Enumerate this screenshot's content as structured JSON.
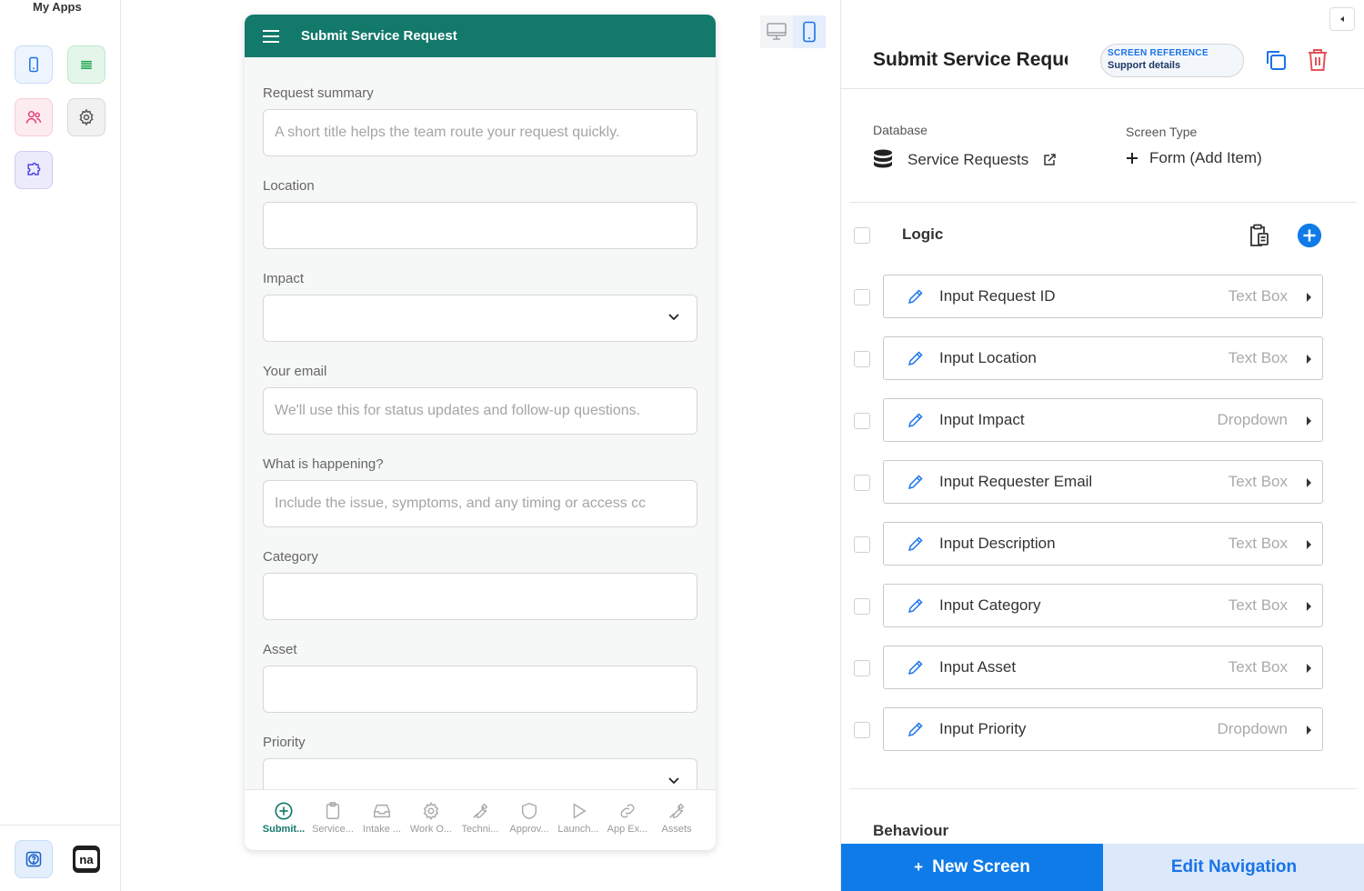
{
  "sidebar": {
    "title": "My Apps",
    "buttons": [
      {
        "icon": "mobile-app-icon",
        "color": "#1a73e8"
      },
      {
        "icon": "list-icon",
        "color": "#16a34a"
      },
      {
        "icon": "users-icon",
        "color": "#e0457b"
      },
      {
        "icon": "gear-icon",
        "color": "#555555"
      },
      {
        "icon": "puzzle-icon",
        "color": "#4f46e5"
      }
    ],
    "bottom": [
      {
        "icon": "help-icon"
      },
      {
        "icon": "na-logo-icon",
        "label": "na"
      }
    ]
  },
  "phone": {
    "header_title": "Submit Service Request",
    "header_color": "#13796b",
    "fields": [
      {
        "label": "Request summary",
        "placeholder": "A short title helps the team route your request quickly.",
        "kind": "text"
      },
      {
        "label": "Location",
        "placeholder": "",
        "kind": "text"
      },
      {
        "label": "Impact",
        "placeholder": "",
        "kind": "dropdown"
      },
      {
        "label": "Your email",
        "placeholder": "We'll use this for status updates and follow-up questions.",
        "kind": "text"
      },
      {
        "label": "What is happening?",
        "placeholder": "Include the issue, symptoms, and any timing or access cc",
        "kind": "text"
      },
      {
        "label": "Category",
        "placeholder": "",
        "kind": "text"
      },
      {
        "label": "Asset",
        "placeholder": "",
        "kind": "text"
      },
      {
        "label": "Priority",
        "placeholder": "",
        "kind": "dropdown"
      }
    ],
    "tabs": [
      {
        "label": "Submit...",
        "icon": "plus-circle-icon",
        "active": true
      },
      {
        "label": "Service...",
        "icon": "clipboard-icon"
      },
      {
        "label": "Intake ...",
        "icon": "inbox-icon"
      },
      {
        "label": "Work O...",
        "icon": "gear-icon"
      },
      {
        "label": "Techni...",
        "icon": "wrench-icon"
      },
      {
        "label": "Approv...",
        "icon": "shield-icon"
      },
      {
        "label": "Launch...",
        "icon": "play-icon"
      },
      {
        "label": "App Ex...",
        "icon": "link-icon"
      },
      {
        "label": "Assets",
        "icon": "wrench-icon"
      }
    ]
  },
  "panel": {
    "screen_name": "Submit Service Request",
    "screen_reference_key": "SCREEN REFERENCE",
    "screen_reference_value": "Support details",
    "database_label": "Database",
    "database_value": "Service Requests",
    "screen_type_label": "Screen Type",
    "screen_type_value": "Form (Add Item)",
    "logic_title": "Logic",
    "items": [
      {
        "name": "Input Request ID",
        "type": "Text Box"
      },
      {
        "name": "Input Location",
        "type": "Text Box"
      },
      {
        "name": "Input Impact",
        "type": "Dropdown"
      },
      {
        "name": "Input Requester Email",
        "type": "Text Box"
      },
      {
        "name": "Input Description",
        "type": "Text Box"
      },
      {
        "name": "Input Category",
        "type": "Text Box"
      },
      {
        "name": "Input Asset",
        "type": "Text Box"
      },
      {
        "name": "Input Priority",
        "type": "Dropdown"
      }
    ],
    "behaviour_title": "Behaviour",
    "new_screen_label": "New Screen",
    "edit_navigation_label": "Edit Navigation",
    "accent": "#0f7be8"
  }
}
